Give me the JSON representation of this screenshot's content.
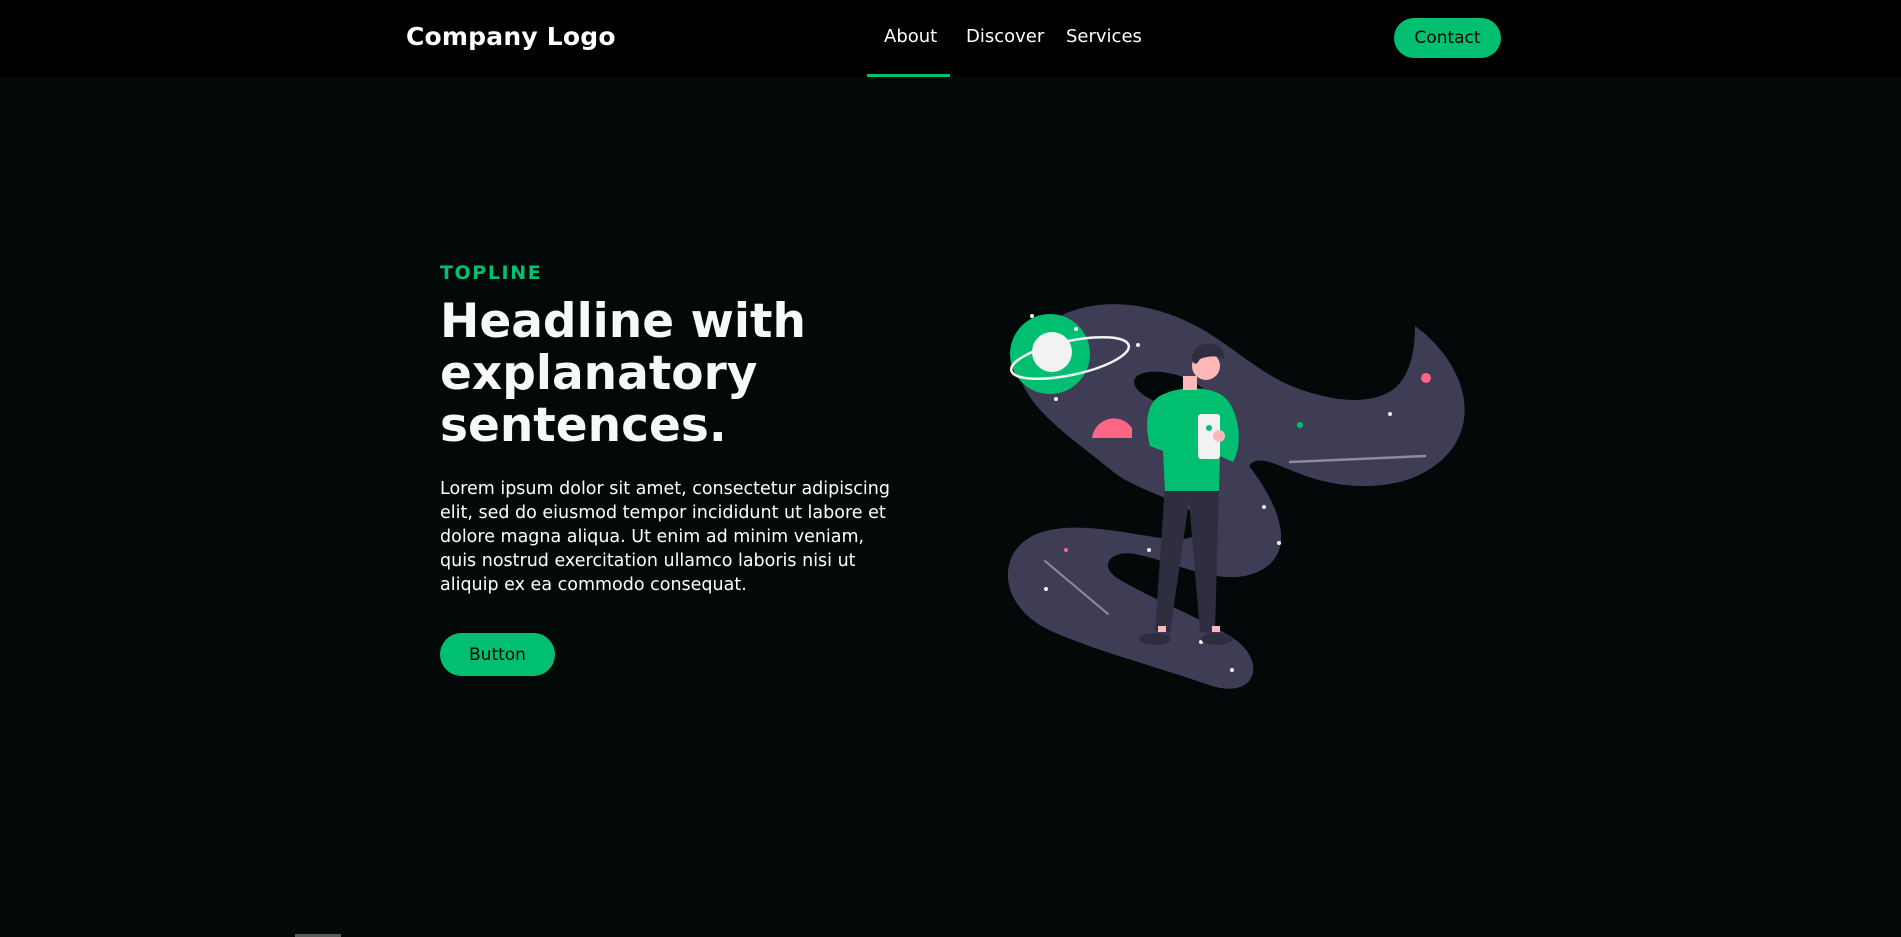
{
  "navbar": {
    "logo": "Company Logo",
    "items": [
      {
        "label": "About",
        "active": true
      },
      {
        "label": "Discover",
        "active": false
      },
      {
        "label": "Services",
        "active": false
      }
    ],
    "contact_label": "Contact"
  },
  "hero": {
    "topline": "TOPLINE",
    "headline": "Headline with explanatory sentences.",
    "description": "Lorem ipsum dolor sit amet, consectetur adipiscing elit, sed do eiusmod tempor incididunt ut labore et dolore magna aliqua. Ut enim ad minim veniam, quis nostrud exercitation ullamco laboris nisi ut aliquip ex ea commodo consequat.",
    "button_label": "Button",
    "illustration_icon": "space-person-illustration"
  },
  "colors": {
    "accent": "#01bf71",
    "background": "#030808",
    "navbar": "#000000",
    "illustration_blob": "#3f3d56",
    "illustration_pink": "#ff6584"
  }
}
